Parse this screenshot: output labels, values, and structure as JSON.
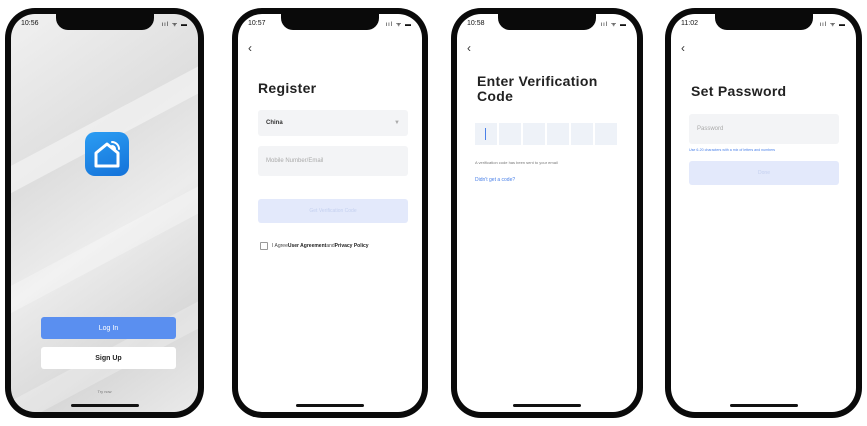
{
  "screens": [
    {
      "time": "10:56",
      "login_button": "Log In",
      "signup_button": "Sign Up",
      "try_link": "Try now"
    },
    {
      "time": "10:57",
      "title": "Register",
      "country": "China",
      "mobile_placeholder": "Mobile Number/Email",
      "code_button": "Get Verification Code",
      "agreement_prefix": "I Agree",
      "agreement_link1": "User Agreement",
      "agreement_and": "and",
      "agreement_link2": "Privacy Policy"
    },
    {
      "time": "10:58",
      "title_line1": "Enter Verification",
      "title_line2": "Code",
      "note": "A verification code has been sent to your email",
      "resend": "Didn't get a code?"
    },
    {
      "time": "11:02",
      "title": "Set Password",
      "password_placeholder": "Password",
      "hint": "Use 6-20 characters with a mix of letters and numbers",
      "done_button": "Done"
    }
  ],
  "status_signal": "ııl ᯤ ▬",
  "colors": {
    "accent": "#4a80e8",
    "primary_button": "#5a8ff0",
    "disabled_button": "#e3e9fb",
    "logo": "#1e88ea"
  }
}
